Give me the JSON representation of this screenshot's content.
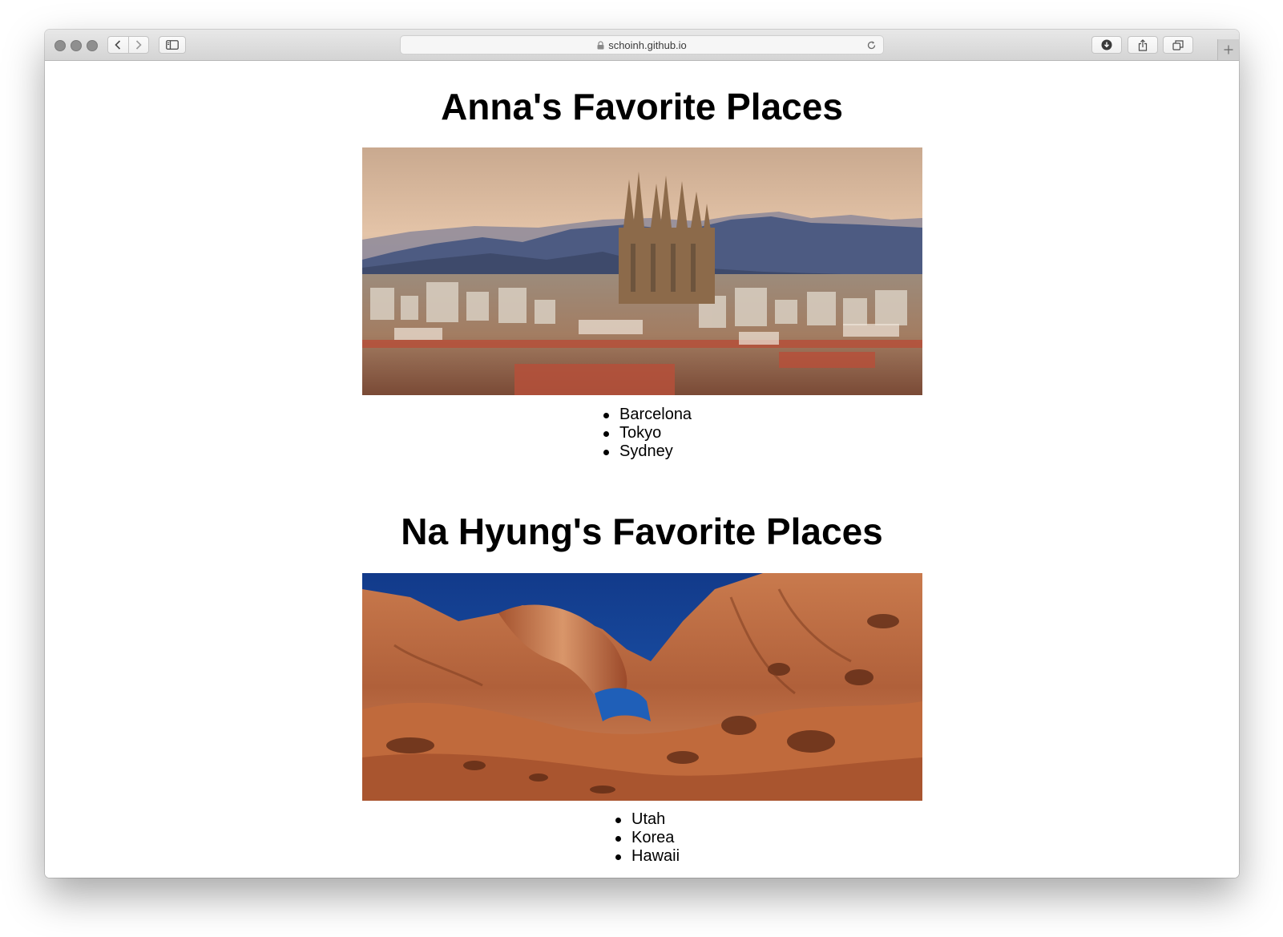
{
  "browser": {
    "url": "schoinh.github.io"
  },
  "sections": [
    {
      "title": "Anna's Favorite Places",
      "places": [
        "Barcelona",
        "Tokyo",
        "Sydney"
      ]
    },
    {
      "title": "Na Hyung's Favorite Places",
      "places": [
        "Utah",
        "Korea",
        "Hawaii"
      ]
    }
  ]
}
